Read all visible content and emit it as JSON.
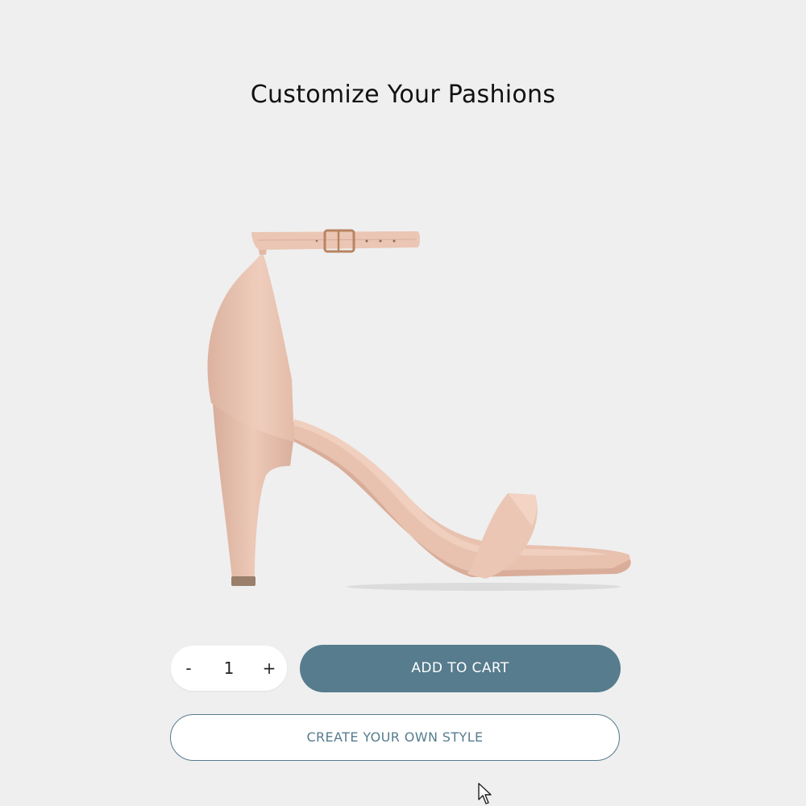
{
  "page": {
    "title": "Customize Your Pashions"
  },
  "product": {
    "image_icon": "high-heel-sandal",
    "color": "#e6bfae"
  },
  "quantity": {
    "decrement_label": "-",
    "value": "1",
    "increment_label": "+"
  },
  "actions": {
    "add_to_cart_label": "ADD TO CART",
    "create_style_label": "CREATE YOUR OWN STYLE"
  },
  "colors": {
    "accent": "#567c8d",
    "background": "#efefef"
  }
}
